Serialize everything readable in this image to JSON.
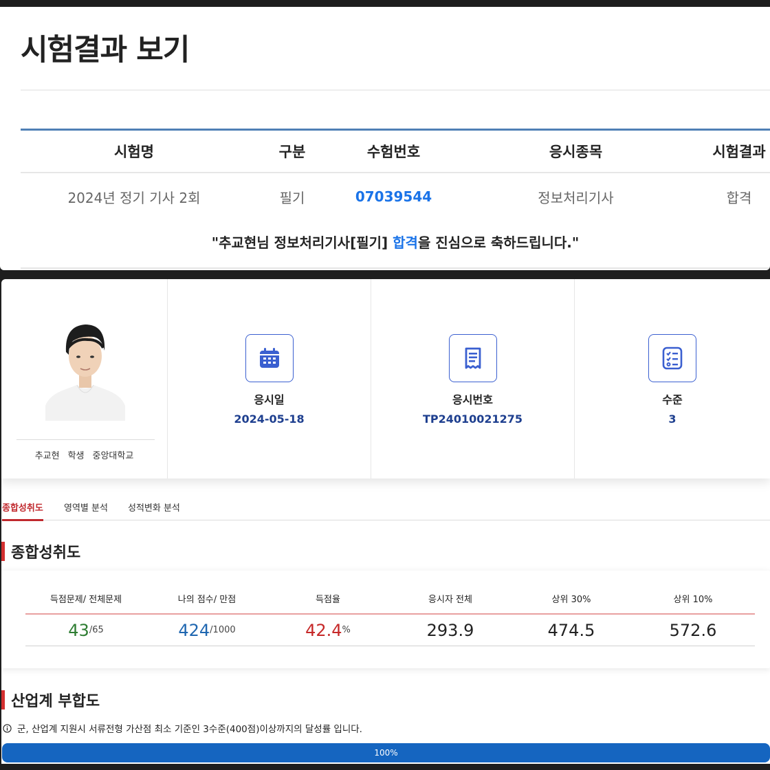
{
  "result": {
    "title": "시험결과 보기",
    "headers": [
      "시험명",
      "구분",
      "수험번호",
      "응시종목",
      "시험결과"
    ],
    "row": {
      "exam_name": "2024년 정기 기사 2회",
      "type": "필기",
      "exam_number": "07039544",
      "subject": "정보처리기사",
      "result": "합격"
    },
    "congrats": {
      "prefix": "\"추교현님 정보처리기사[필기] ",
      "highlight": "합격",
      "suffix": "을 진심으로 축하드립니다.\""
    }
  },
  "profile": {
    "name": "추교현",
    "role": "학생",
    "school": "중앙대학교"
  },
  "info_cards": [
    {
      "label": "응시일",
      "value": "2024-05-18",
      "icon": "calendar-icon"
    },
    {
      "label": "응시번호",
      "value": "TP24010021275",
      "icon": "receipt-icon"
    },
    {
      "label": "수준",
      "value": "3",
      "icon": "checklist-icon"
    }
  ],
  "tabs": [
    "종합성취도",
    "영역별 분석",
    "성적변화 분석"
  ],
  "overall": {
    "title": "종합성취도",
    "headers": [
      "득점문제/ 전체문제",
      "나의 점수/ 만점",
      "득점율",
      "응시자 전체",
      "상위 30%",
      "상위 10%"
    ],
    "correct": "43",
    "total_questions": "/65",
    "my_score": "424",
    "max_score": "/1000",
    "rate": "42.4",
    "rate_unit": "%",
    "all_avg": "293.9",
    "top30": "474.5",
    "top10": "572.6"
  },
  "industry": {
    "title": "산업계 부합도",
    "note": "군, 산업계 지원시 서류전형 가산점 최소 기준인 3수준(400점)이상까지의 달성률 입니다.",
    "progress_label": "100%",
    "progress": 1.0
  },
  "colors": {
    "accent_red": "#c0282d",
    "link_blue": "#1a73e8",
    "value_navy": "#1e3f8f",
    "progress_blue": "#1565c0"
  }
}
